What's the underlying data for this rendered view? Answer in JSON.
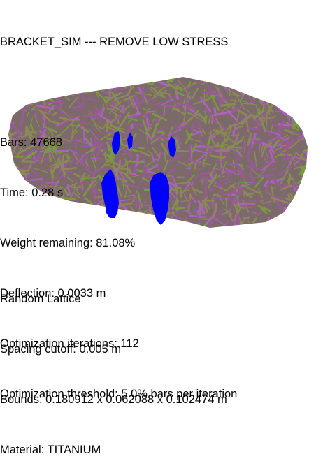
{
  "window": {
    "title": "BRACKET_SIM --- REMOVE LOW STRESS"
  },
  "stats": {
    "bars": "Bars: 47668",
    "time": "Time: 0.28 s",
    "weight_remaining": "Weight remaining: 81.08%",
    "deflection": "Deflection: 0.0033 m",
    "optimization_iterations": "Optimization iterations: 112",
    "optimization_threshold": "Optimization threshold: 5.0% bars per iteration"
  },
  "lattice_info": {
    "type": "Random Lattice",
    "spacing_cutoff": "Spacing cutoff: 0.005 m",
    "bounds": "Bounds: 0.180912 x 0.062088 x 0.102474 m",
    "material": "Material: TITANIUM"
  },
  "colors": {
    "background": "#ffffff",
    "strut_olive": "#8a8a55",
    "strut_purple": "#9a5a9a",
    "strut_magenta": "#b060c0",
    "strut_green": "#7a9a40",
    "high_stress_blue": "#0000ff",
    "text": "#000000"
  }
}
